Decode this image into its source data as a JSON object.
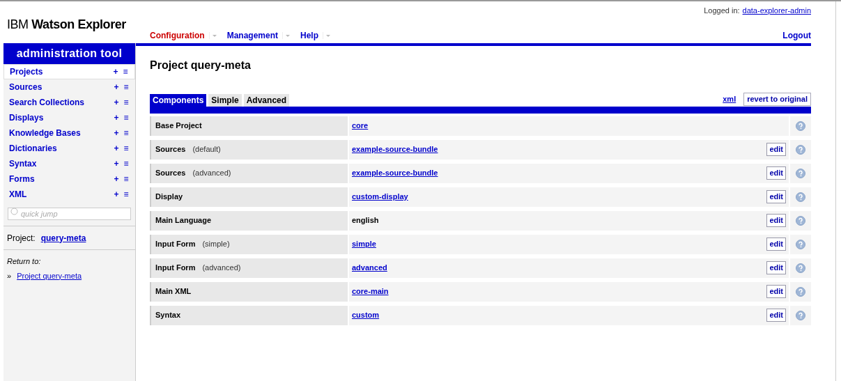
{
  "logo": {
    "light": "IBM",
    "bold": "Watson Explorer"
  },
  "login": {
    "label": "Logged in:",
    "user": "data-explorer-admin"
  },
  "nav": [
    {
      "label": "Configuration",
      "selected": true
    },
    {
      "label": "Management",
      "selected": false
    },
    {
      "label": "Help",
      "selected": false
    }
  ],
  "logout": "Logout",
  "sidebar": {
    "title": "administration tool",
    "items": [
      {
        "label": "Projects",
        "selected": true
      },
      {
        "label": "Sources",
        "selected": false
      },
      {
        "label": "Search Collections",
        "selected": false
      },
      {
        "label": "Displays",
        "selected": false
      },
      {
        "label": "Knowledge Bases",
        "selected": false
      },
      {
        "label": "Dictionaries",
        "selected": false
      },
      {
        "label": "Syntax",
        "selected": false
      },
      {
        "label": "Forms",
        "selected": false
      },
      {
        "label": "XML",
        "selected": false
      }
    ],
    "add_symbol": "+",
    "list_symbol": "≡",
    "quick_jump": {
      "placeholder": "quick jump"
    },
    "project": {
      "label": "Project:",
      "value": "query-meta"
    },
    "return_to": {
      "label": "Return to:",
      "bullet": "»",
      "link": "Project query-meta"
    }
  },
  "page_title": "Project query-meta",
  "tabs": [
    {
      "label": "Components",
      "selected": true
    },
    {
      "label": "Simple",
      "selected": false
    },
    {
      "label": "Advanced",
      "selected": false
    }
  ],
  "xml_link": "xml",
  "revert_button": "revert to original",
  "rows": [
    {
      "label": "Base Project",
      "value": "core",
      "kind": "link"
    },
    {
      "label": "Sources",
      "qualifier": "(default)",
      "value": "example-source-bundle",
      "kind": "link",
      "edit": "edit"
    },
    {
      "label": "Sources",
      "qualifier": "(advanced)",
      "value": "example-source-bundle",
      "kind": "link",
      "edit": "edit"
    },
    {
      "label": "Display",
      "value": "custom-display",
      "kind": "link",
      "edit": "edit"
    },
    {
      "label": "Main Language",
      "value": "english",
      "kind": "text",
      "edit": "edit"
    },
    {
      "label": "Input Form",
      "qualifier": "(simple)",
      "value": "simple",
      "kind": "link",
      "edit": "edit"
    },
    {
      "label": "Input Form",
      "qualifier": "(advanced)",
      "value": "advanced",
      "kind": "link",
      "edit": "edit"
    },
    {
      "label": "Main XML",
      "value": "core-main",
      "kind": "link",
      "edit": "edit"
    },
    {
      "label": "Syntax",
      "value": "custom",
      "kind": "link",
      "edit": "edit"
    }
  ]
}
